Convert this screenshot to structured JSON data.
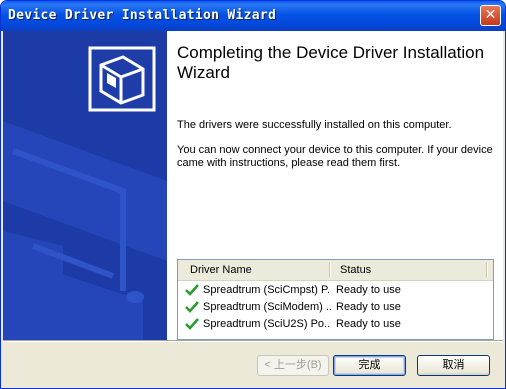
{
  "window": {
    "title": "Device Driver Installation Wizard"
  },
  "heading": "Completing the Device Driver Installation Wizard",
  "message1": "The drivers were successfully installed on this computer.",
  "message2": "You can now connect your device to this computer. If your device came with instructions, please read them first.",
  "table": {
    "columns": [
      "Driver Name",
      "Status"
    ],
    "rows": [
      {
        "name": "Spreadtrum (SciCmpst) P...",
        "status": "Ready to use"
      },
      {
        "name": "Spreadtrum (SciModem) ...",
        "status": "Ready to use"
      },
      {
        "name": "Spreadtrum (SciU2S) Po...",
        "status": "Ready to use"
      }
    ]
  },
  "buttons": {
    "back": "< 上一步(B)",
    "finish": "完成",
    "cancel": "取消"
  },
  "icons": {
    "close": "close-icon",
    "wizard": "hardware-box-icon",
    "row_status": "green-check-icon"
  },
  "colors": {
    "title_bar": "#0453e6",
    "side_panel": "#1c3ba7",
    "check": "#2a9b2e"
  }
}
